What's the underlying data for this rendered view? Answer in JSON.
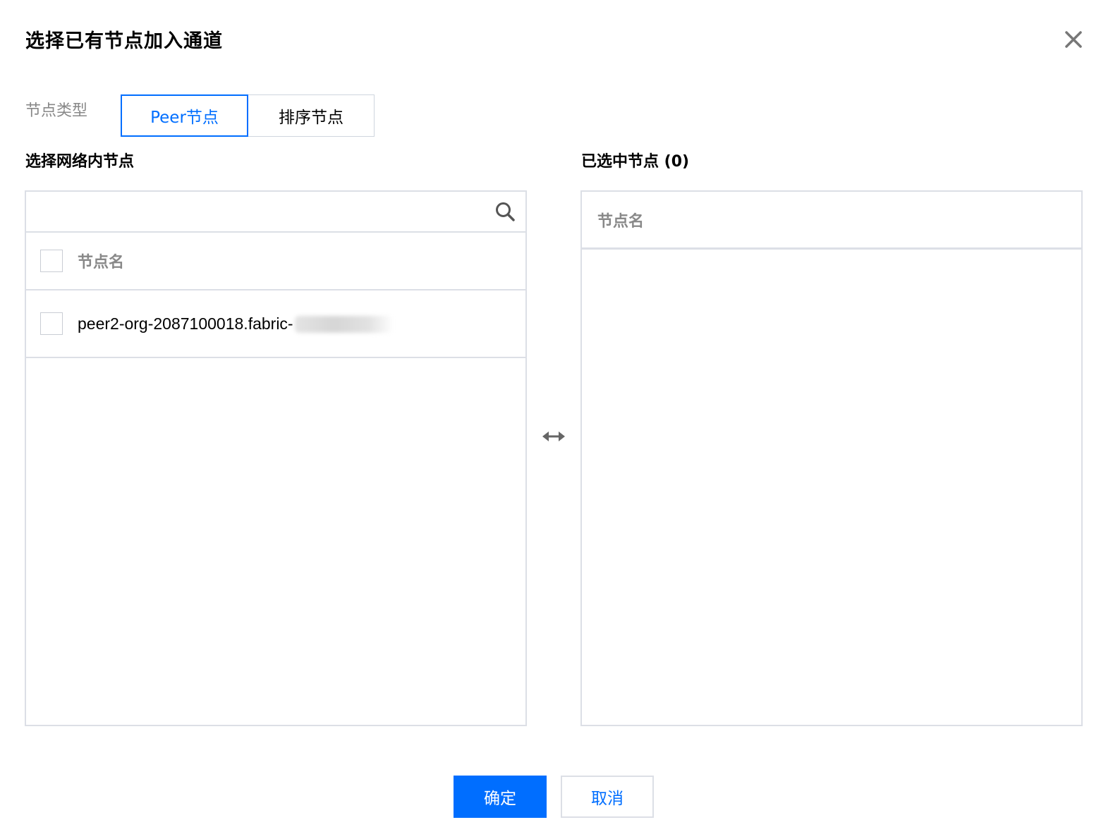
{
  "dialog": {
    "title": "选择已有节点加入通道",
    "close_icon": "close-icon"
  },
  "node_type": {
    "label": "节点类型",
    "options": [
      "Peer节点",
      "排序节点"
    ],
    "selected": "Peer节点"
  },
  "left_panel": {
    "title": "选择网络内节点",
    "search": {
      "value": "",
      "placeholder": ""
    },
    "column_header": "节点名",
    "rows": [
      {
        "name": "peer2-org-2087100018.fabric-",
        "checked": false,
        "redacted_suffix": true
      }
    ]
  },
  "right_panel": {
    "title": "已选中节点 (0)",
    "column_header": "节点名",
    "rows": []
  },
  "transfer_icon": "swap-horizontal-icon",
  "footer": {
    "confirm_label": "确定",
    "cancel_label": "取消"
  },
  "colors": {
    "accent": "#006eff",
    "border": "#dcdfe6",
    "muted_text": "#888888"
  }
}
